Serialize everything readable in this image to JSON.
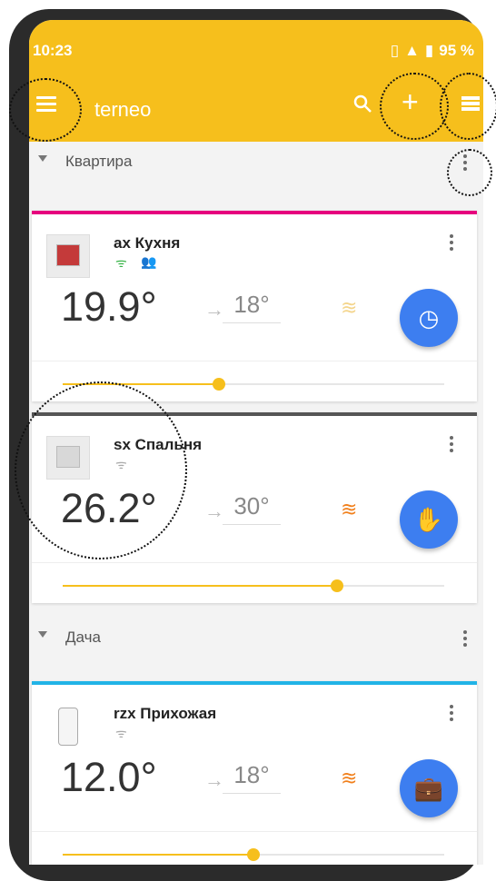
{
  "status": {
    "time": "10:23",
    "battery": "95 %"
  },
  "toolbar": {
    "title": "terneo"
  },
  "colors": {
    "brand": "#f6bf1c",
    "fab": "#3d7ef0",
    "heat_on": "#f1801c",
    "stripe_kvartira": "#e6007e",
    "stripe_dacha": "#21b3e6"
  },
  "groups": [
    {
      "name": "Квартира"
    },
    {
      "name": "Дача"
    }
  ],
  "devices": [
    {
      "name": "ax Кухня",
      "temperature": "19.9°",
      "setpoint": "18°",
      "heating": "off",
      "mode_icon": "clock-icon",
      "slider_level": 0.41
    },
    {
      "name": "sx Спальня",
      "temperature": "26.2°",
      "setpoint": "30°",
      "heating": "on",
      "mode_icon": "hand-icon",
      "slider_level": 0.72
    },
    {
      "name": "rzx Прихожая",
      "temperature": "12.0°",
      "setpoint": "18°",
      "heating": "on",
      "mode_icon": "briefcase-icon",
      "slider_level": 0.5
    }
  ]
}
